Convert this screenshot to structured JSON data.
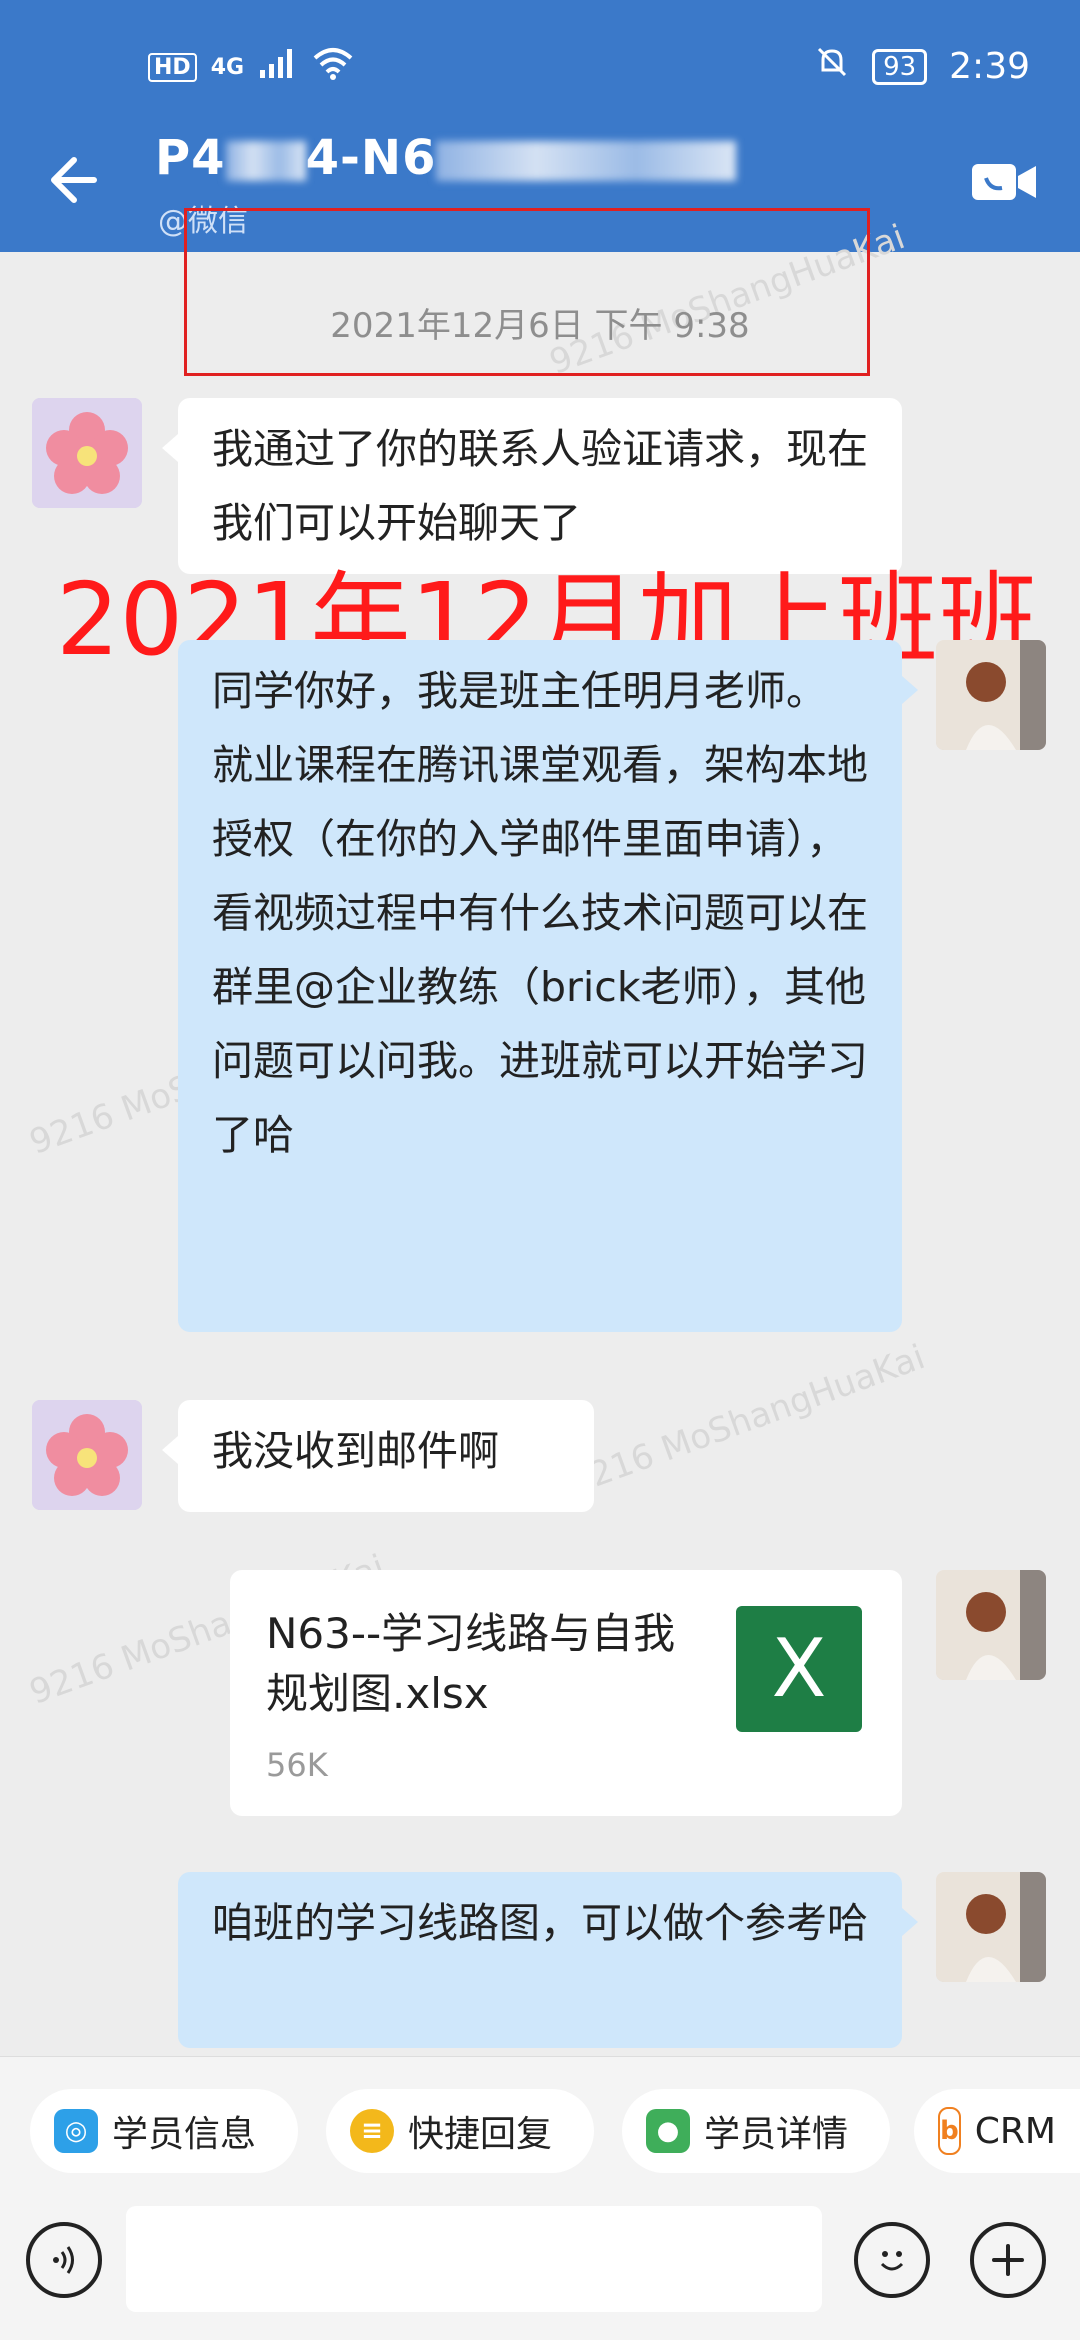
{
  "status_bar": {
    "hd": "HD",
    "net": "4G",
    "battery": "93",
    "time": "2:39"
  },
  "header": {
    "title_prefix": "P4",
    "title_mid": "4-N6",
    "subtitle": "@微信"
  },
  "chat": {
    "timestamp": "2021年12月6日 下午 9:38",
    "overlay": "2021年12月加上班班",
    "messages": {
      "m1": "我通过了你的联系人验证请求，现在我们可以开始聊天了",
      "m2": "同学你好，我是班主任明月老师。\n就业课程在腾讯课堂观看，架构本地授权（在你的入学邮件里面申请），看视频过程中有什么技术问题可以在群里@企业教练（brick老师），其他问题可以问我。进班就可以开始学习了哈",
      "m3": "我没收到邮件啊",
      "m5": "咱班的学习线路图，可以做个参考哈"
    },
    "file": {
      "name": "N63--学习线路与自我规划图.xlsx",
      "size": "56K",
      "icon_letter": "X"
    }
  },
  "quick_bar": {
    "chip1": "学员信息",
    "chip2": "快捷回复",
    "chip3": "学员详情",
    "chip4": "CRM"
  },
  "watermark": {
    "line1": "9216",
    "line2": "MoShangHuaKai"
  },
  "colors": {
    "header": "#3b79c9",
    "bubble_blue": "#cfe7fb",
    "overlay_red": "#ff1a1a",
    "excel": "#1e7e45"
  }
}
